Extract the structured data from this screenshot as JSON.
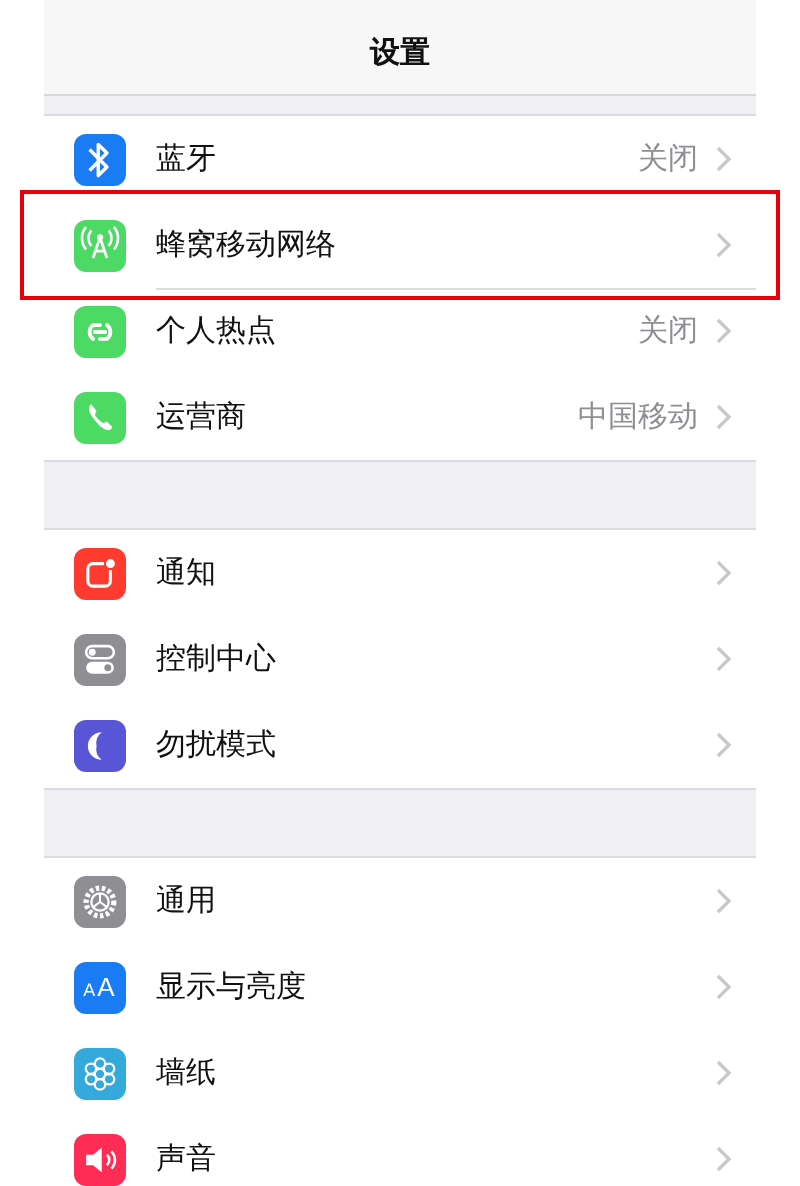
{
  "navigation_bar": {
    "title": "设置"
  },
  "groups": [
    {
      "items": [
        {
          "kind": "bluetooth",
          "label": "蓝牙",
          "value": "关闭",
          "highlighted": false
        },
        {
          "kind": "antenna",
          "label": "蜂窝移动网络",
          "highlighted": true
        },
        {
          "kind": "link",
          "label": "个人热点",
          "value": "关闭",
          "highlighted": false
        },
        {
          "kind": "phone",
          "label": "运营商",
          "value": "中国移动",
          "highlighted": false
        }
      ]
    },
    {
      "items": [
        {
          "kind": "notification",
          "label": "通知",
          "highlighted": false
        },
        {
          "kind": "toggles",
          "label": "控制中心",
          "highlighted": false
        },
        {
          "kind": "moon",
          "label": "勿扰模式",
          "highlighted": false
        }
      ]
    },
    {
      "items": [
        {
          "kind": "gear",
          "label": "通用",
          "highlighted": false
        },
        {
          "kind": "text-size",
          "icon_label": "AA",
          "label": "显示与亮度",
          "highlighted": false
        },
        {
          "kind": "flower",
          "label": "墙纸",
          "highlighted": false
        },
        {
          "kind": "speaker",
          "label": "声音",
          "highlighted": false
        }
      ]
    }
  ]
}
